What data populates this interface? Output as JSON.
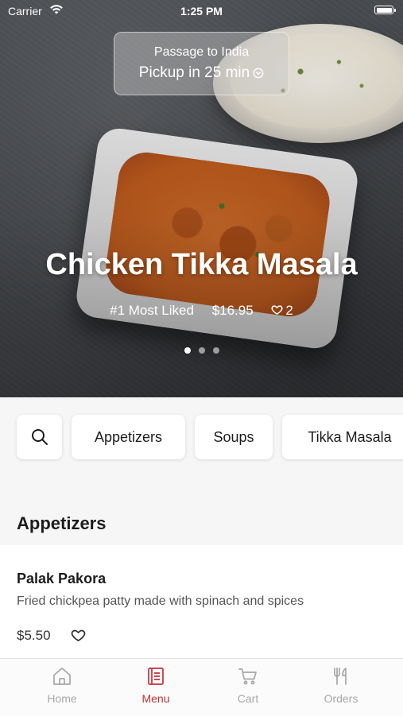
{
  "status_bar": {
    "carrier": "Carrier",
    "time": "1:25 PM"
  },
  "pickup": {
    "restaurant": "Passage to India",
    "time_label": "Pickup in 25 min"
  },
  "featured": {
    "title": "Chicken Tikka Masala",
    "rank": "#1 Most Liked",
    "price": "$16.95",
    "likes": "2",
    "slide_count": 3,
    "active_slide": 1
  },
  "categories": [
    "Appetizers",
    "Soups",
    "Tikka Masala"
  ],
  "section": {
    "title": "Appetizers"
  },
  "items": [
    {
      "name": "Palak Pakora",
      "description": "Fried chickpea patty made with spinach and spices",
      "price": "$5.50"
    }
  ],
  "tabs": [
    {
      "label": "Home",
      "icon": "home-icon"
    },
    {
      "label": "Menu",
      "icon": "menu-book-icon",
      "active": true
    },
    {
      "label": "Cart",
      "icon": "cart-icon"
    },
    {
      "label": "Orders",
      "icon": "fork-knife-icon"
    }
  ],
  "colors": {
    "accent": "#c5303a",
    "inactive": "#a7a7a7",
    "background": "#f6f6f6"
  }
}
